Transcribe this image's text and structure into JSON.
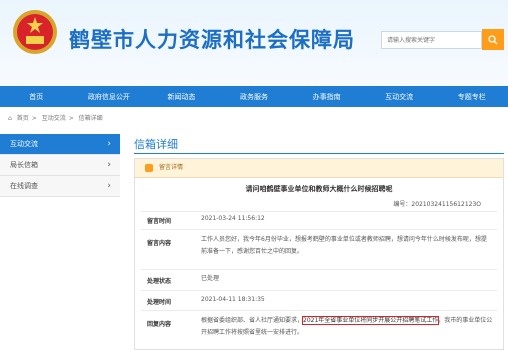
{
  "site": {
    "title": "鹤壁市人力资源和社会保障局",
    "search_placeholder": "请输入搜索关键字"
  },
  "nav": [
    "首页",
    "政府信息公开",
    "新闻动态",
    "政务服务",
    "办事指南",
    "互动交流",
    "专题专栏"
  ],
  "breadcrumb": [
    "首页",
    "互动交流",
    "信箱详细"
  ],
  "sidebar": [
    {
      "label": "互动交流",
      "active": true
    },
    {
      "label": "局长信箱",
      "active": false
    },
    {
      "label": "在线调查",
      "active": false
    }
  ],
  "section_title": "信箱详细",
  "panel": {
    "head_label": "留言详情",
    "title": "请问咱鹤壁事业单位和教师大概什么时候招聘呢",
    "msg_id": "编号：20210324115612123O",
    "rows": [
      {
        "label": "留言时间",
        "value": "2021-03-24 11:56:12"
      },
      {
        "label": "留言内容",
        "value": "工作人员您好，我今年6月份毕业，想报考鹤壁的事业单位或者教师招聘，想请问今年什么时候发布呢，想提前准备一下，感谢您百忙之中的回复。"
      },
      {
        "label": "处理状态",
        "value": "已处理"
      },
      {
        "label": "处理时间",
        "value": "2021-04-11 18:31:35"
      },
      {
        "label": "回复内容",
        "value_pre": "根据省委组织部、省人社厅通知要求，",
        "value_highlight": "2021年全省事业单位将同步开展公开招聘笔试工作",
        "value_post": "，我市的事业单位公开招聘工作将按照省里统一安排进行。"
      }
    ]
  }
}
